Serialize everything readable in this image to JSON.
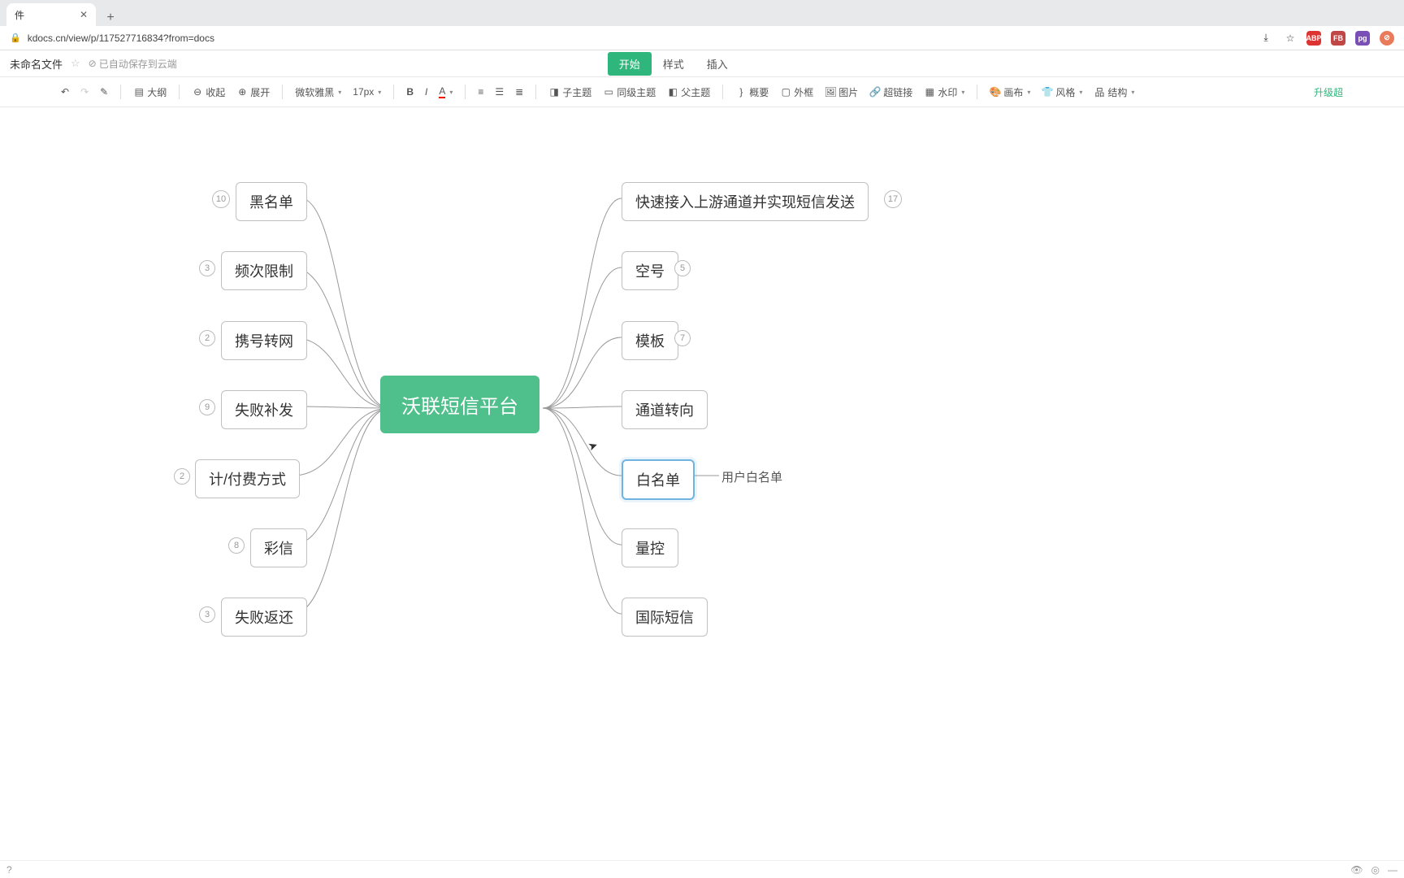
{
  "browser": {
    "tab_label": "件",
    "url": "kdocs.cn/view/p/117527716834?from=docs",
    "extensions": {
      "abp": "ABP",
      "fb": "FB",
      "pg": "pg"
    }
  },
  "doc": {
    "title": "未命名文件",
    "cloud_status": "已自动保存到云端",
    "tabs": {
      "start": "开始",
      "style": "样式",
      "insert": "插入"
    }
  },
  "toolbar": {
    "outline": "大纲",
    "collapse": "收起",
    "expand": "展开",
    "font": "微软雅黑",
    "fontsize": "17px",
    "subtopic": "子主题",
    "peertopic": "同级主题",
    "parenttopic": "父主题",
    "summary": "概要",
    "border": "外框",
    "image": "图片",
    "hyperlink": "超链接",
    "watermark": "水印",
    "canvas": "画布",
    "style": "风格",
    "structure": "结构",
    "upgrade": "升级超"
  },
  "mindmap": {
    "central": "沃联短信平台",
    "left": [
      {
        "label": "黑名单",
        "badge": "10"
      },
      {
        "label": "频次限制",
        "badge": "3"
      },
      {
        "label": "携号转网",
        "badge": "2"
      },
      {
        "label": "失败补发",
        "badge": "9"
      },
      {
        "label": "计/付费方式",
        "badge": "2"
      },
      {
        "label": "彩信",
        "badge": "8"
      },
      {
        "label": "失败返还",
        "badge": "3"
      }
    ],
    "right": [
      {
        "label": "快速接入上游通道并实现短信发送",
        "badge": "17"
      },
      {
        "label": "空号",
        "badge": "5"
      },
      {
        "label": "模板",
        "badge": "7"
      },
      {
        "label": "通道转向"
      },
      {
        "label": "白名单",
        "selected": true,
        "child": "用户白名单"
      },
      {
        "label": "量控"
      },
      {
        "label": "国际短信"
      }
    ]
  }
}
